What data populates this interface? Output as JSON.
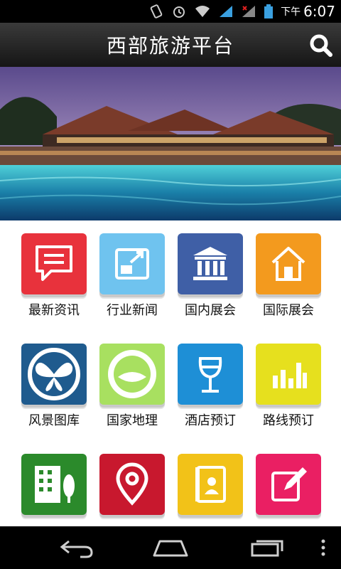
{
  "status_bar": {
    "time_prefix": "下午",
    "time": "6:07",
    "icons": [
      "vibrate-icon",
      "alarm-icon",
      "wifi-icon",
      "signal-icon",
      "signal-icon",
      "battery-icon"
    ]
  },
  "header": {
    "title": "西部旅游平台",
    "search_icon": "search-icon"
  },
  "banner": {
    "image": "resort-pool-dusk"
  },
  "tiles": [
    {
      "label": "最新资讯",
      "icon": "message-icon",
      "color": "#e8323c"
    },
    {
      "label": "行业新闻",
      "icon": "expand-icon",
      "color": "#6fc3ef"
    },
    {
      "label": "国内展会",
      "icon": "museum-icon",
      "color": "#3f5fa6"
    },
    {
      "label": "国际展会",
      "icon": "house-icon",
      "color": "#f39a1e"
    },
    {
      "label": "风景图库",
      "icon": "butterfly-icon",
      "color": "#1f5b8e"
    },
    {
      "label": "国家地理",
      "icon": "circle-icon",
      "color": "#a8e060"
    },
    {
      "label": "酒店预订",
      "icon": "wine-glass-icon",
      "color": "#1e8fd6"
    },
    {
      "label": "路线预订",
      "icon": "bar-chart-icon",
      "color": "#e6e01e"
    },
    {
      "label": "",
      "icon": "building-icon",
      "color": "#2b8a2b"
    },
    {
      "label": "",
      "icon": "location-pin-icon",
      "color": "#c8182e"
    },
    {
      "label": "",
      "icon": "contact-book-icon",
      "color": "#f2c218"
    },
    {
      "label": "",
      "icon": "edit-icon",
      "color": "#ea1f63"
    }
  ],
  "nav": {
    "icons": [
      "back-icon",
      "home-icon",
      "recent-apps-icon",
      "menu-icon"
    ]
  }
}
